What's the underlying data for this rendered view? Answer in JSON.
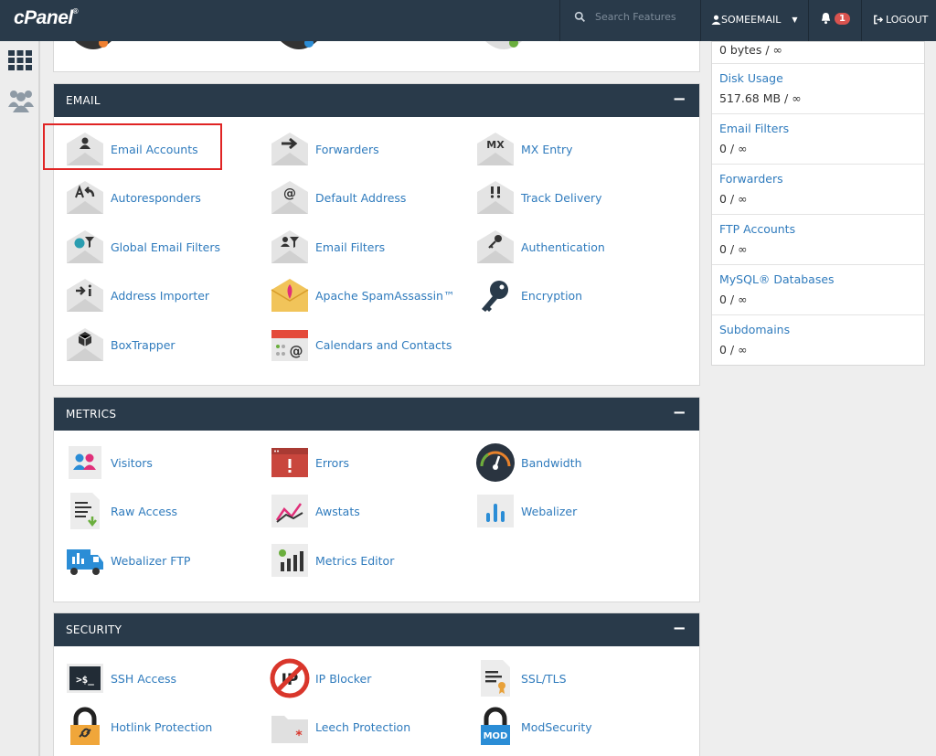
{
  "topbar": {
    "logo": "cPanel",
    "logo_mark": "®",
    "search_placeholder": "Search Features",
    "username": "SOMEEMAIL",
    "notification_count": "1",
    "logout_label": "LOGOUT"
  },
  "email": {
    "title": "EMAIL",
    "items": [
      {
        "label": "Email Accounts"
      },
      {
        "label": "Forwarders"
      },
      {
        "label": "MX Entry"
      },
      {
        "label": "Autoresponders"
      },
      {
        "label": "Default Address"
      },
      {
        "label": "Track Delivery"
      },
      {
        "label": "Global Email Filters"
      },
      {
        "label": "Email Filters"
      },
      {
        "label": "Authentication"
      },
      {
        "label": "Address Importer"
      },
      {
        "label": "Apache SpamAssassin™"
      },
      {
        "label": "Encryption"
      },
      {
        "label": "BoxTrapper"
      },
      {
        "label": "Calendars and Contacts"
      }
    ]
  },
  "metrics": {
    "title": "METRICS",
    "items": [
      {
        "label": "Visitors"
      },
      {
        "label": "Errors"
      },
      {
        "label": "Bandwidth"
      },
      {
        "label": "Raw Access"
      },
      {
        "label": "Awstats"
      },
      {
        "label": "Webalizer"
      },
      {
        "label": "Webalizer FTP"
      },
      {
        "label": "Metrics Editor"
      }
    ]
  },
  "security": {
    "title": "SECURITY",
    "items": [
      {
        "label": "SSH Access"
      },
      {
        "label": "IP Blocker"
      },
      {
        "label": "SSL/TLS"
      },
      {
        "label": "Hotlink Protection"
      },
      {
        "label": "Leech Protection"
      },
      {
        "label": "ModSecurity"
      }
    ]
  },
  "stats": {
    "first_value": "0 bytes / ∞",
    "items": [
      {
        "name": "Disk Usage",
        "value": "517.68 MB / ∞"
      },
      {
        "name": "Email Filters",
        "value": "0 / ∞"
      },
      {
        "name": "Forwarders",
        "value": "0 / ∞"
      },
      {
        "name": "FTP Accounts",
        "value": "0 / ∞"
      },
      {
        "name": "MySQL® Databases",
        "value": "0 / ∞"
      },
      {
        "name": "Subdomains",
        "value": "0 / ∞"
      }
    ]
  },
  "ssh_glyph": ">$_",
  "mod_glyph": "MOD",
  "mx_glyph": "MX",
  "colors": {
    "topbar": "#293a4a",
    "link": "#2f7bbd",
    "highlight": "#e02424",
    "badge": "#d9534f"
  }
}
